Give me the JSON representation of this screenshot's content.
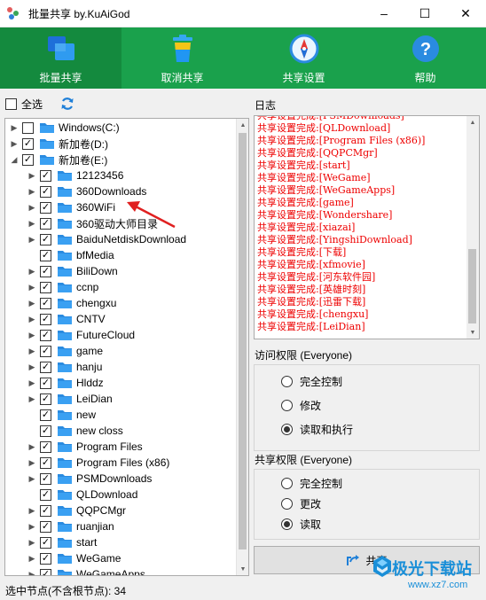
{
  "window": {
    "title": "批量共享 by.KuAiGod",
    "minimize": "–",
    "maximize": "☐",
    "close": "✕"
  },
  "toolbar": {
    "items": [
      {
        "label": "批量共享",
        "icon": "windows-share-icon"
      },
      {
        "label": "取消共享",
        "icon": "trash-bin-icon"
      },
      {
        "label": "共享设置",
        "icon": "compass-icon"
      },
      {
        "label": "帮助",
        "icon": "help-icon"
      }
    ]
  },
  "left": {
    "select_all_label": "全选",
    "select_all_checked": false,
    "refresh_icon": "refresh-icon"
  },
  "tree": {
    "drives": [
      {
        "label": "Windows(C:)",
        "checked": false,
        "expanded": false
      },
      {
        "label": "新加卷(D:)",
        "checked": true,
        "expanded": false
      },
      {
        "label": "新加卷(E:)",
        "checked": true,
        "expanded": true
      }
    ],
    "children": [
      {
        "label": "12123456",
        "checked": true,
        "has_children": true
      },
      {
        "label": "360Downloads",
        "checked": true,
        "has_children": true
      },
      {
        "label": "360WiFi",
        "checked": true,
        "has_children": true
      },
      {
        "label": "360驱动大师目录",
        "checked": true,
        "has_children": true
      },
      {
        "label": "BaiduNetdiskDownload",
        "checked": true,
        "has_children": true
      },
      {
        "label": "bfMedia",
        "checked": true,
        "has_children": false
      },
      {
        "label": "BiliDown",
        "checked": true,
        "has_children": true
      },
      {
        "label": "ccnp",
        "checked": true,
        "has_children": true
      },
      {
        "label": "chengxu",
        "checked": true,
        "has_children": true
      },
      {
        "label": "CNTV",
        "checked": true,
        "has_children": true
      },
      {
        "label": "FutureCloud",
        "checked": true,
        "has_children": true
      },
      {
        "label": "game",
        "checked": true,
        "has_children": true
      },
      {
        "label": "hanju",
        "checked": true,
        "has_children": true
      },
      {
        "label": "Hlddz",
        "checked": true,
        "has_children": true
      },
      {
        "label": "LeiDian",
        "checked": true,
        "has_children": true
      },
      {
        "label": "new",
        "checked": true,
        "has_children": false
      },
      {
        "label": "new closs",
        "checked": true,
        "has_children": false
      },
      {
        "label": "Program Files",
        "checked": true,
        "has_children": true
      },
      {
        "label": "Program Files (x86)",
        "checked": true,
        "has_children": true
      },
      {
        "label": "PSMDownloads",
        "checked": true,
        "has_children": true
      },
      {
        "label": "QLDownload",
        "checked": true,
        "has_children": false
      },
      {
        "label": "QQPCMgr",
        "checked": true,
        "has_children": true
      },
      {
        "label": "ruanjian",
        "checked": true,
        "has_children": true
      },
      {
        "label": "start",
        "checked": true,
        "has_children": true
      },
      {
        "label": "WeGame",
        "checked": true,
        "has_children": true
      },
      {
        "label": "WeGameApps",
        "checked": true,
        "has_children": true
      }
    ]
  },
  "log": {
    "title": "日志",
    "prefix": "共享设置完成:",
    "entries": [
      "[PSMDownloads]",
      "[QLDownload]",
      "[Program Files (x86)]",
      "[QQPCMgr]",
      "[start]",
      "[WeGame]",
      "[WeGameApps]",
      "[game]",
      "[Wondershare]",
      "[xiazai]",
      "[YingshiDownload]",
      "[下载]",
      "[xfmovie]",
      "[河东软件园]",
      "[英雄时刻]",
      "[迅雷下载]",
      "[chengxu]",
      "[LeiDian]"
    ]
  },
  "access": {
    "title": "访问权限 (Everyone)",
    "options": [
      "完全控制",
      "修改",
      "读取和执行"
    ],
    "selected": 2
  },
  "share_perm": {
    "title": "共享权限 (Everyone)",
    "options": [
      "完全控制",
      "更改",
      "读取"
    ],
    "selected": 2
  },
  "share_button": {
    "label": "共享"
  },
  "status": {
    "text": "选中节点(不含根节点): 34"
  },
  "watermark": {
    "text": "极光下载站",
    "url": "www.xz7.com"
  },
  "colors": {
    "toolbar_green": "#1aa14c",
    "toolbar_active": "#148a3e",
    "log_red": "#e00000",
    "folder_blue": "#2a8be0",
    "annotation_red": "#e02020"
  }
}
